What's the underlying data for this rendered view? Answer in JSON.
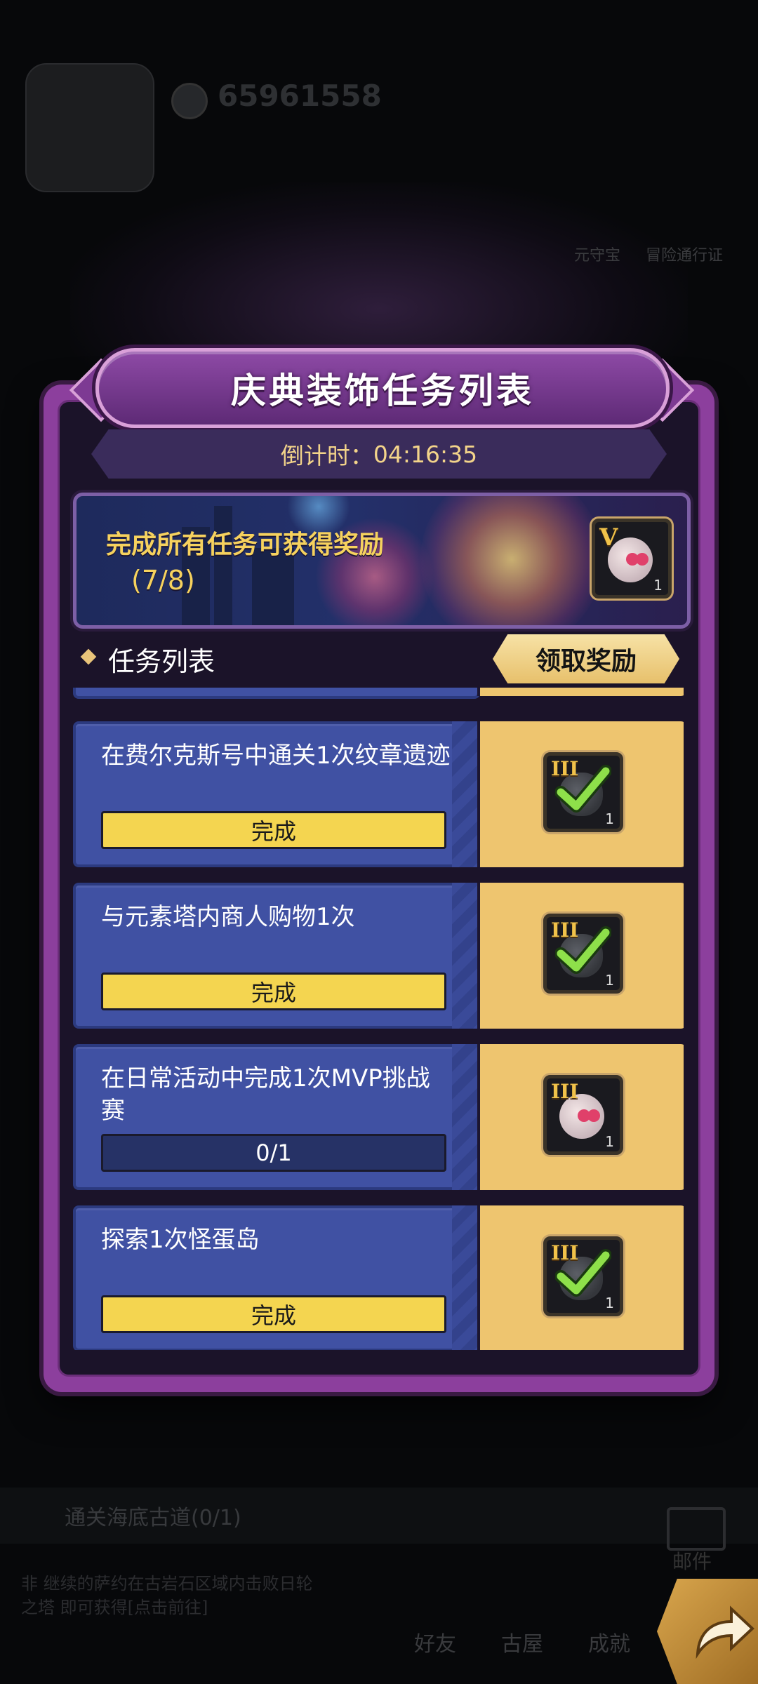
{
  "background": {
    "gold": "65961558",
    "quest_text": "通关海底古道(0/1)",
    "quest_desc": "非 继续的萨约在古岩石区域内击败日轮之塔 即可获得[点击前往]",
    "mail_label": "邮件",
    "side_labels": [
      "元守宝",
      "冒险通行证"
    ],
    "nav_items": [
      "好友",
      "古屋",
      "成就"
    ]
  },
  "modal": {
    "title": "庆典装饰任务列表",
    "countdown_label": "倒计时：",
    "countdown_value": "04:16:35",
    "reward_banner": {
      "text": "完成所有任务可获得奖励",
      "progress": "(7/8)",
      "item_tier": "V",
      "item_count": "1"
    },
    "list_header": "任务列表",
    "claim_button": "领取奖励",
    "tasks": [
      {
        "desc": "在费尔克斯号中通关1次纹章遗迹",
        "status": "完成",
        "completed": true,
        "reward_tier": "III",
        "reward_count": "1"
      },
      {
        "desc": "与元素塔内商人购物1次",
        "status": "完成",
        "completed": true,
        "reward_tier": "III",
        "reward_count": "1"
      },
      {
        "desc": "在日常活动中完成1次MVP挑战赛",
        "status": "0/1",
        "completed": false,
        "reward_tier": "III",
        "reward_count": "1"
      },
      {
        "desc": "探索1次怪蛋岛",
        "status": "完成",
        "completed": true,
        "reward_tier": "III",
        "reward_count": "1"
      }
    ]
  },
  "colors": {
    "modal_border": "#8c3f9d",
    "task_bg": "#4051a3",
    "reward_bg": "#eec56f",
    "progress_done": "#f4d550",
    "gold_text": "#f6d25e"
  },
  "icons": {
    "check": "check-icon",
    "bag": "reward-bag-icon",
    "share": "share-arrow-icon",
    "diamond": "diamond-bullet-icon"
  }
}
